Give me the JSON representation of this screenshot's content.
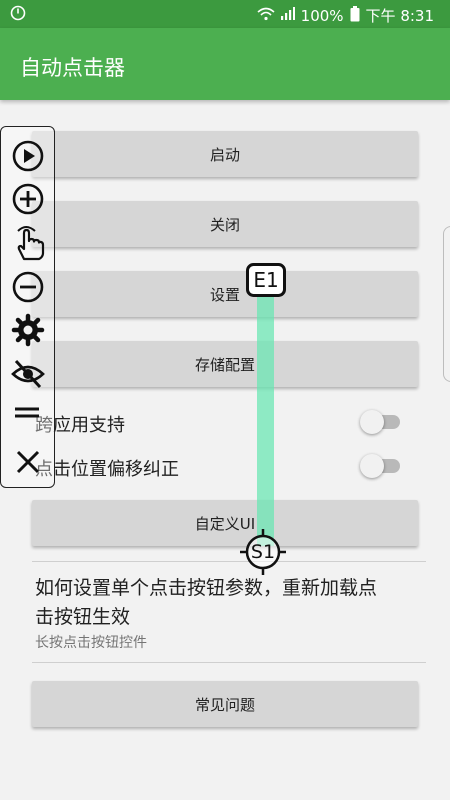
{
  "status_bar": {
    "battery": "100%",
    "time": "下午 8:31"
  },
  "app_bar": {
    "title": "自动点击器"
  },
  "buttons": {
    "start": "启动",
    "close": "关闭",
    "settings": "设置",
    "save_config": "存储配置",
    "custom_ui": "自定义UI",
    "faq": "常见问题"
  },
  "switches": [
    {
      "label": "跨应用支持",
      "on": false
    },
    {
      "label": "点击位置偏移纠正",
      "on": false
    }
  ],
  "info": {
    "title": "如何设置单个点击按钮参数，重新加载点击按钮生效",
    "subtitle": "长按点击按钮控件"
  },
  "markers": {
    "end_label": "E1",
    "start_label": "S1"
  },
  "colors": {
    "status_bar": "#3c9a3f",
    "app_bar": "#4caf50",
    "connector": "#66e6b2"
  },
  "toolbar_icons": [
    "play-icon",
    "add-icon",
    "touch-hand-icon",
    "remove-icon",
    "gear-icon",
    "eye-off-icon",
    "menu-icon",
    "close-icon"
  ]
}
